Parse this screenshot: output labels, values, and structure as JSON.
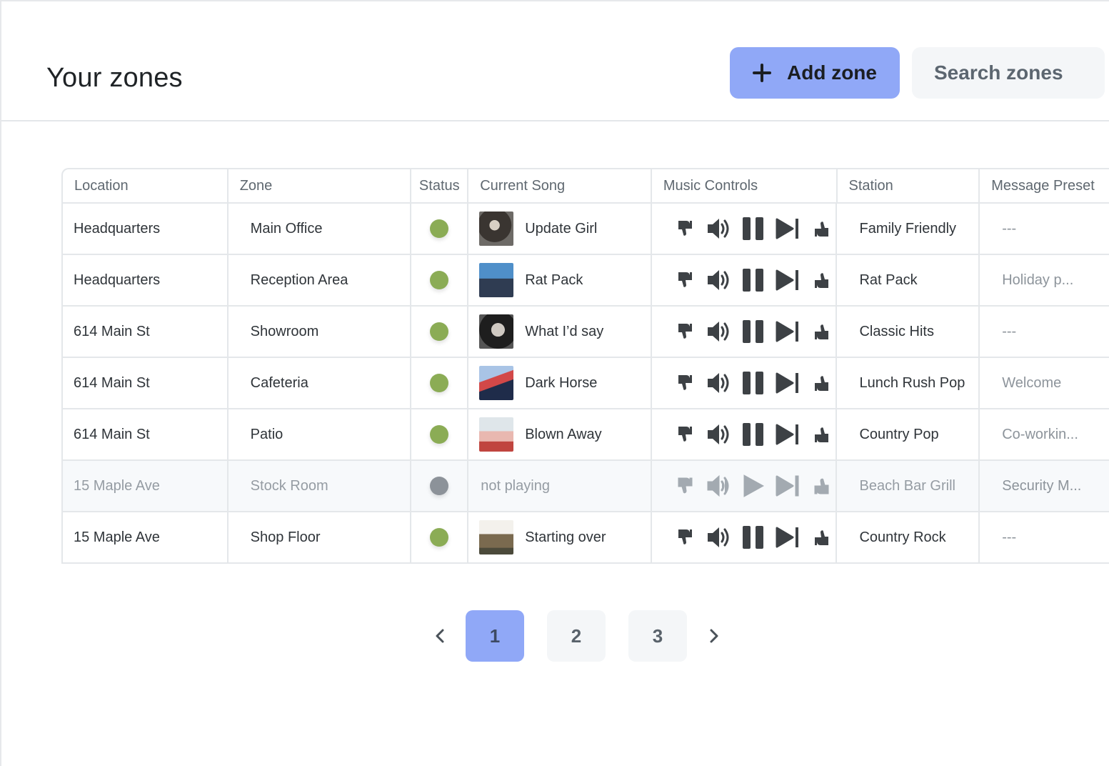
{
  "header": {
    "title": "Your zones",
    "add_button_label": "Add zone",
    "search_placeholder": "Search zones"
  },
  "table": {
    "columns": [
      "Location",
      "Zone",
      "Status",
      "Current Song",
      "Music Controls",
      "Station",
      "Message Preset"
    ],
    "rows": [
      {
        "location": "Headquarters",
        "zone": "Main Office",
        "status": "playing",
        "status_color": "#8bac55",
        "song": "Update Girl",
        "play_state": "pause",
        "station": "Family Friendly",
        "preset": "---"
      },
      {
        "location": "Headquarters",
        "zone": "Reception Area",
        "status": "playing",
        "status_color": "#8bac55",
        "song": "Rat Pack",
        "play_state": "pause",
        "station": "Rat Pack",
        "preset": "Holiday p..."
      },
      {
        "location": "614 Main St",
        "zone": "Showroom",
        "status": "playing",
        "status_color": "#8bac55",
        "song": "What I’d say",
        "play_state": "pause",
        "station": "Classic Hits",
        "preset": "---"
      },
      {
        "location": "614 Main St",
        "zone": "Cafeteria",
        "status": "playing",
        "status_color": "#8bac55",
        "song": "Dark Horse",
        "play_state": "pause",
        "station": "Lunch Rush Pop",
        "preset": "Welcome"
      },
      {
        "location": "614 Main St",
        "zone": "Patio",
        "status": "playing",
        "status_color": "#8bac55",
        "song": "Blown Away",
        "play_state": "pause",
        "station": "Country Pop",
        "preset": "Co-workin..."
      },
      {
        "location": "15 Maple Ave",
        "zone": "Stock Room",
        "status": "offline",
        "status_color": "#8c9299",
        "song": "not playing",
        "play_state": "play",
        "station": "Beach Bar Grill",
        "preset": "Security M..."
      },
      {
        "location": "15 Maple Ave",
        "zone": "Shop Floor",
        "status": "playing",
        "status_color": "#8bac55",
        "song": "Starting over",
        "play_state": "pause",
        "station": "Country Rock",
        "preset": "---"
      }
    ]
  },
  "pagination": {
    "pages": [
      "1",
      "2",
      "3"
    ],
    "current": "1"
  },
  "colors": {
    "accent": "#90a8f7",
    "status_playing": "#8bac55",
    "status_offline": "#8c9299"
  },
  "icons": [
    "plus-icon",
    "thumbs-down-icon",
    "volume-icon",
    "pause-icon",
    "play-icon",
    "skip-next-icon",
    "thumbs-up-icon",
    "chevron-left-icon",
    "chevron-right-icon"
  ]
}
